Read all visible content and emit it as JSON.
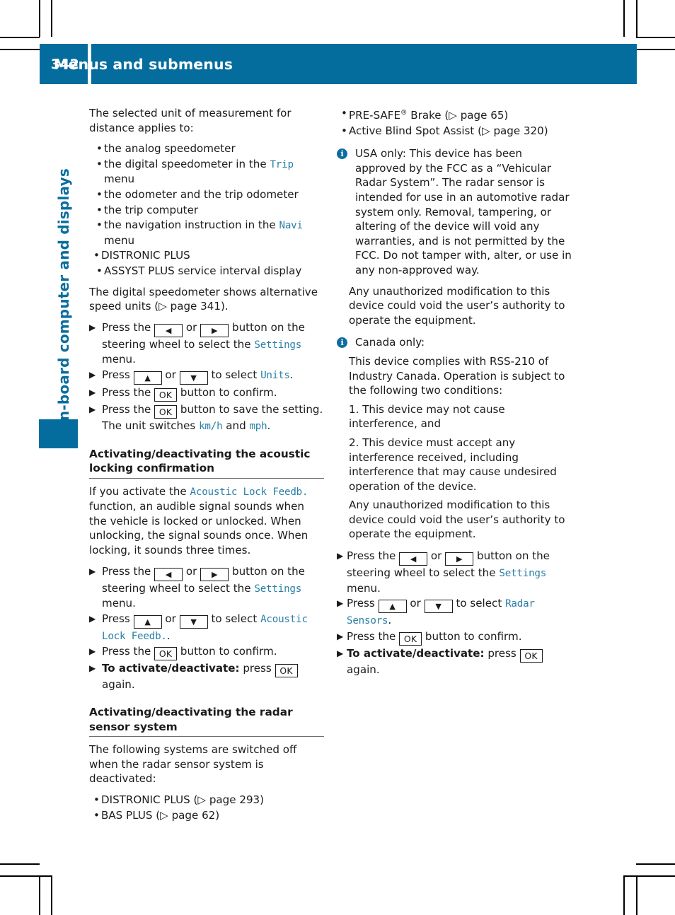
{
  "colors": {
    "brand_blue": "#056d9e",
    "accent_mono_blue": "#2a7fa6",
    "text": "#1b1b1b",
    "rule_gray": "#6e6e6e"
  },
  "header": {
    "page_number": "342",
    "title": "Menus and submenus"
  },
  "chapter_tab": {
    "label": "On-board computer and displays"
  },
  "left_column": {
    "intro": "The selected unit of measurement for distance applies to:",
    "bullets": [
      {
        "pre": "the analog speedometer",
        "mono": "",
        "post": ""
      },
      {
        "pre": "the digital speedometer in the ",
        "mono": "Trip",
        "post": " menu"
      },
      {
        "pre": "the odometer and the trip odometer",
        "mono": "",
        "post": ""
      },
      {
        "pre": "the trip computer",
        "mono": "",
        "post": ""
      },
      {
        "pre": "the navigation instruction in the ",
        "mono": "Navi",
        "post": " menu"
      },
      {
        "pre": "DISTRONIC PLUS",
        "mono": "",
        "post": ""
      },
      {
        "pre": "ASSYST PLUS service interval display",
        "mono": "",
        "post": ""
      }
    ],
    "speedo_para_a": "The digital speedometer shows alternative speed units (",
    "speedo_para_ref": "page 341",
    "speedo_para_b": ").",
    "steps_units": {
      "s1_a": "Press the",
      "s1_or": "or",
      "s1_b": "button on the steering wheel to select the",
      "s1_mono": "Settings",
      "s1_c": "menu.",
      "s2_a": "Press",
      "s2_or": "or",
      "s2_b": "to select",
      "s2_mono": "Units",
      "s2_c": ".",
      "s3_a": "Press the",
      "s3_b": "button to confirm.",
      "s4_a": "Press the",
      "s4_b": "button to save the setting. The unit switches",
      "s4_mono1": "km/h",
      "s4_mid": "and",
      "s4_mono2": "mph",
      "s4_c": "."
    },
    "heading_acoustic": "Activating/deactivating the acoustic locking confirmation",
    "acoustic_para_a": "If you activate the",
    "acoustic_para_mono": "Acoustic Lock Feedb.",
    "acoustic_para_b": "function, an audible signal sounds when the vehicle is locked or unlocked. When unlocking, the signal sounds once. When locking, it sounds three times.",
    "steps_acoustic": {
      "s1_a": "Press the",
      "s1_or": "or",
      "s1_b": "button on the steering wheel to select the",
      "s1_mono": "Settings",
      "s1_c": "menu.",
      "s2_a": "Press",
      "s2_or": "or",
      "s2_b": "to select",
      "s2_mono": "Acoustic Lock Feedb.",
      "s2_c": ".",
      "s3_a": "Press the",
      "s3_b": "button to confirm.",
      "s4_bold": "To activate/deactivate:",
      "s4_a": "press",
      "s4_b": "again."
    },
    "heading_radar": "Activating/deactivating the radar sensor system",
    "radar_intro": "The following systems are switched off when the radar sensor system is deactivated:",
    "radar_bullets": [
      {
        "label": "DISTRONIC PLUS",
        "ref": "page 293"
      },
      {
        "label": "BAS PLUS",
        "ref": "page 62"
      }
    ]
  },
  "right_column": {
    "bullets": [
      {
        "label": "PRE-SAFE",
        "sup": "®",
        "label2": " Brake",
        "ref": "page 65"
      },
      {
        "label": "Active Blind Spot Assist",
        "sup": "",
        "label2": "",
        "ref": "page 320"
      }
    ],
    "note_usa": {
      "icon": "i",
      "first": "USA only: This device has been approved by the FCC as a “Vehicular Radar System”. The radar sensor is intended for use in an automotive radar system only. Removal, tampering, or altering of the device will void any warranties, and is not permitted by the FCC. Do not tamper with, alter, or use in any non-approved way.",
      "second": "Any unauthorized modification to this device could void the user’s authority to operate the equipment."
    },
    "note_canada": {
      "icon": "i",
      "first": "Canada only:",
      "p1": "This device complies with RSS-210 of Industry Canada. Operation is subject to the following two conditions:",
      "p2": "1. This device may not cause interference, and",
      "p3": "2. This device must accept any interference received, including interference that may cause undesired operation of the device.",
      "p4": "Any unauthorized modification to this device could void the user’s authority to operate the equipment."
    },
    "steps_radar": {
      "s1_a": "Press the",
      "s1_or": "or",
      "s1_b": "button on the steering wheel to select the",
      "s1_mono": "Settings",
      "s1_c": "menu.",
      "s2_a": "Press",
      "s2_or": "or",
      "s2_b": "to select",
      "s2_mono": "Radar Sensors",
      "s2_c": ".",
      "s3_a": "Press the",
      "s3_b": "button to confirm.",
      "s4_bold": "To activate/deactivate:",
      "s4_a": "press",
      "s4_b": "again."
    }
  },
  "glyphs": {
    "bullet": "•",
    "step_arrow": "▶",
    "page_ref_arrow": "▷",
    "key_left": "◀",
    "key_right": "▶",
    "key_up": "▲",
    "key_down": "▼",
    "key_ok": "OK",
    "paren_open": "(",
    "paren_close": ")"
  }
}
